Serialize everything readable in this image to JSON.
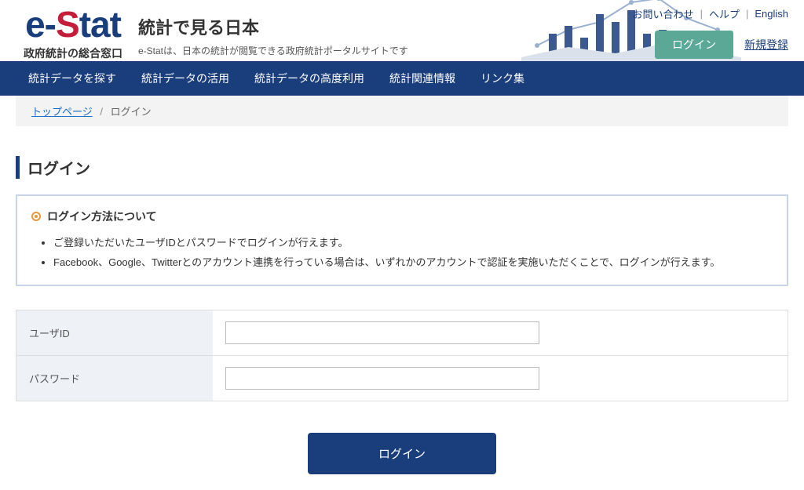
{
  "logo": {
    "sub": "政府統計の総合窓口"
  },
  "tagline": {
    "title": "統計で見る日本",
    "desc": "e-Statは、日本の統計が閲覧できる政府統計ポータルサイトです"
  },
  "top_links": {
    "contact": "お問い合わせ",
    "help": "ヘルプ",
    "english": "English"
  },
  "auth": {
    "login": "ログイン",
    "register": "新規登録"
  },
  "nav": {
    "items": [
      "統計データを探す",
      "統計データの活用",
      "統計データの高度利用",
      "統計関連情報",
      "リンク集"
    ]
  },
  "breadcrumb": {
    "home": "トップページ",
    "current": "ログイン"
  },
  "page": {
    "title": "ログイン"
  },
  "info": {
    "title": "ログイン方法について",
    "items": [
      "ご登録いただいたユーザIDとパスワードでログインが行えます。",
      "Facebook、Google、Twitterとのアカウント連携を行っている場合は、いずれかのアカウントで認証を実施いただくことで、ログインが行えます。"
    ]
  },
  "form": {
    "user_id_label": "ユーザID",
    "password_label": "パスワード",
    "submit": "ログイン"
  }
}
